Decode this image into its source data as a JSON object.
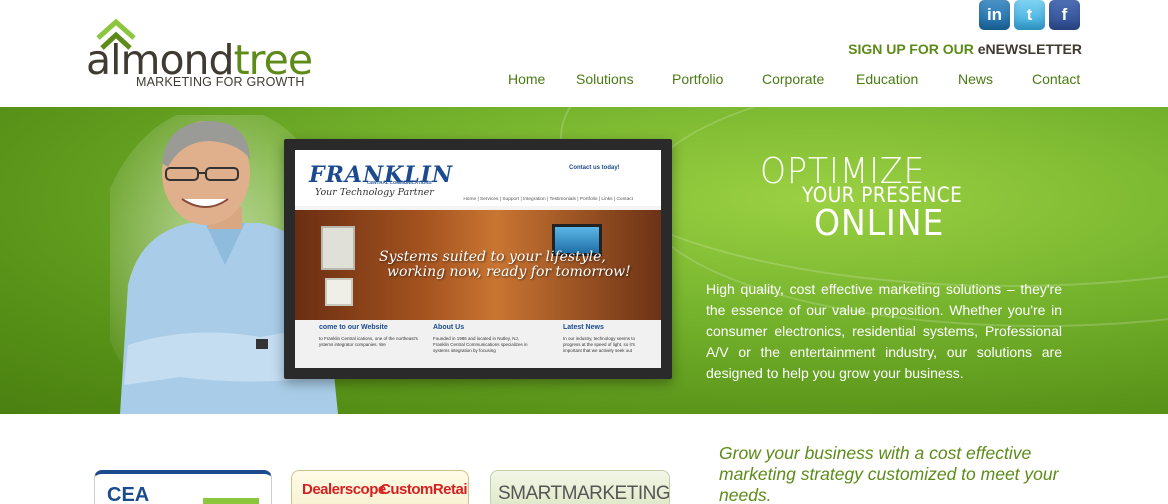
{
  "logo": {
    "word_part1": "almond",
    "word_part2": "tree",
    "tagline": "MARKETING FOR GROWTH"
  },
  "social": [
    {
      "name": "linkedin-icon",
      "glyph": "in",
      "color": "#1a6aa6"
    },
    {
      "name": "twitter-icon",
      "glyph": "t",
      "color": "#35a7db"
    },
    {
      "name": "facebook-icon",
      "glyph": "f",
      "color": "#2d4d92"
    }
  ],
  "newsletter": {
    "prefix": "SIGN UP FOR OUR ",
    "suffix": "eNEWSLETTER"
  },
  "nav": [
    "Home",
    "Solutions",
    "Portfolio",
    "Corporate",
    "Education",
    "News",
    "Contact"
  ],
  "hero": {
    "heading_line1": "OPTIMIZE",
    "heading_line2": "YOUR PRESENCE",
    "heading_line3": "ONLINE",
    "paragraph": "High quality, cost effective marketing solutions – they're the essence of our value proposition. Whether you're in consumer electronics, residential systems, Professional A/V or the entertainment industry, our solutions are designed to help you grow your business.",
    "accent_color": "#74b22c"
  },
  "portfolio_screen": {
    "logo": "FRANKLIN",
    "logo_sub": "CENTRAL COMMUNICATIONS",
    "tagline": "Your Technology Partner",
    "contact": "Contact us today!",
    "nav": "Home | Services | Support | Integration | Testimonials | Portfolio | Links | Contact",
    "slogan_line1": "Systems suited to your lifestyle,",
    "slogan_line2": "working now, ready for tomorrow!",
    "col1_title": "come to our Website",
    "col1_text": "to Franklin Central ications, one of the northeast's ystems integrator companies. We",
    "col2_title": "About Us",
    "col2_text": "Founded in 1986 and located in Nutley, NJ, Franklin Central Communications specializes in systems integration by focusing",
    "col3_title": "Latest News",
    "col3_text": "In our industry, technology seems to progress at the speed of light, so it's important that we actively seek out"
  },
  "bottom": {
    "grow_text": "Grow your business with a cost effective marketing strategy customized to meet your needs.",
    "badge1": "CEA",
    "badge2a": "Dealerscope",
    "badge2b": "CustomRetailer",
    "badge3": "SMARTMARKETING"
  }
}
